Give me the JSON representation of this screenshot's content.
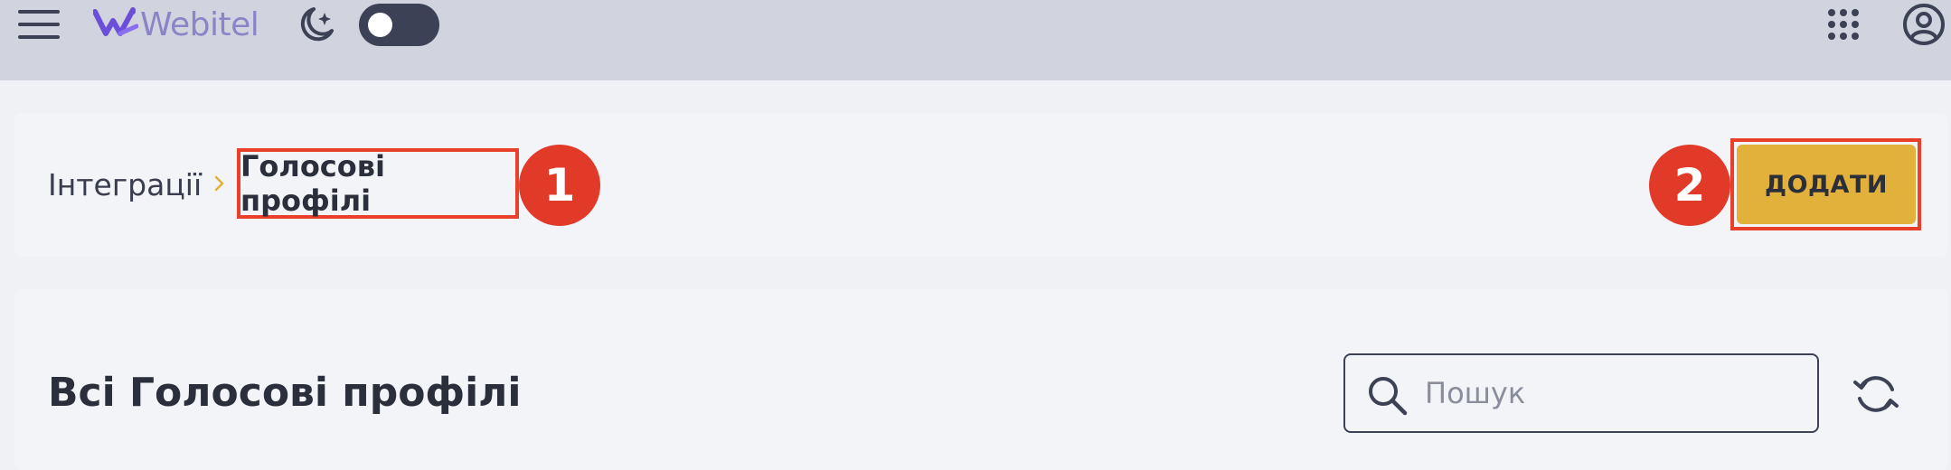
{
  "header": {
    "logo_text": "Webitel",
    "icons": {
      "menu": "hamburger-menu-icon",
      "theme": "moon-sparkle-icon",
      "apps": "apps-grid-icon",
      "account": "account-circle-icon"
    },
    "theme_toggle_on": false
  },
  "breadcrumb": {
    "root": "Інтеграції",
    "separator_icon": "chevron-right-icon",
    "current": "Голосові профілі"
  },
  "annotations": {
    "badge_1": "1",
    "badge_2": "2",
    "highlight_color": "#e8402a"
  },
  "actions": {
    "add_label": "ДОДАТИ"
  },
  "list": {
    "title": "Всі Голосові профілі",
    "search_placeholder": "Пошук",
    "search_value": "",
    "refresh_icon": "refresh-icon"
  },
  "colors": {
    "header_bg": "#d1d3de",
    "accent": "#e2b13c",
    "logo": "#8b84c7",
    "badge": "#e23a28"
  }
}
